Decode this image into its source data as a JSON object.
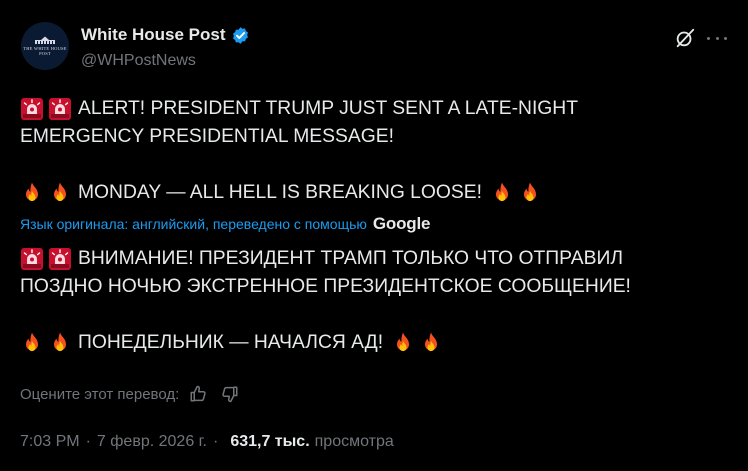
{
  "author": {
    "display_name": "White House Post",
    "handle": "@WHPostNews",
    "avatar_text": "THE WHITE HOUSE POST"
  },
  "post": {
    "original_lines": [
      {
        "emoji": [
          "siren-icon",
          "siren-icon"
        ],
        "text": "ALERT! PRESIDENT TRUMP JUST SENT A LATE-NIGHT"
      },
      {
        "emoji": [],
        "text": "EMERGENCY PRESIDENTIAL MESSAGE!"
      },
      {
        "emoji": [
          "fire-icon",
          "fire-icon"
        ],
        "text": "MONDAY — ALL HELL IS BREAKING LOOSE!",
        "trailing_emoji": [
          "fire-icon",
          "fire-icon"
        ]
      }
    ],
    "translation_note": "Язык оригинала: английский, переведено с помощью",
    "translation_provider": "Google",
    "translated_lines": [
      {
        "emoji": [
          "siren-icon",
          "siren-icon"
        ],
        "text": "ВНИМАНИЕ! ПРЕЗИДЕНТ ТРАМП ТОЛЬКО ЧТО ОТПРАВИЛ"
      },
      {
        "emoji": [],
        "text": "ПОЗДНО НОЧЬЮ ЭКСТРЕННОЕ ПРЕЗИДЕНТСКОЕ СООБЩЕНИЕ!"
      },
      {
        "emoji": [
          "fire-icon",
          "fire-icon"
        ],
        "text": "ПОНЕДЕЛЬНИК — НАЧАЛСЯ АД!",
        "trailing_emoji": [
          "fire-icon",
          "fire-icon"
        ]
      }
    ]
  },
  "rate": {
    "label": "Оцените этот перевод:"
  },
  "meta": {
    "time": "7:03 PM",
    "date": "7 февр. 2026 г.",
    "separator": "·",
    "views_count": "631,7 тыс.",
    "views_label": "просмотра"
  },
  "colors": {
    "background": "#000000",
    "text": "#e7e9ea",
    "muted": "#71767b",
    "link": "#1d9bf0",
    "verified": "#1d9bf0"
  }
}
